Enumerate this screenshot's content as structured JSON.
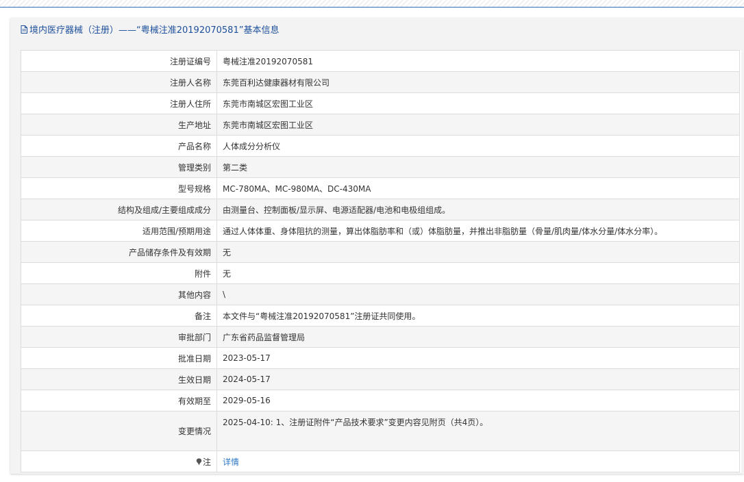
{
  "panel": {
    "title": "境内医疗器械（注册）——“粤械注准20192070581”基本信息",
    "title_color": "#1d4f9c",
    "icon": "document-icon"
  },
  "rows": [
    {
      "label": "注册证编号",
      "value": "粤械注准20192070581"
    },
    {
      "label": "注册人名称",
      "value": "东莞百利达健康器材有限公司"
    },
    {
      "label": "注册人住所",
      "value": "东莞市南城区宏图工业区"
    },
    {
      "label": "生产地址",
      "value": "东莞市南城区宏图工业区"
    },
    {
      "label": "产品名称",
      "value": "人体成分分析仪"
    },
    {
      "label": "管理类别",
      "value": "第二类"
    },
    {
      "label": "型号规格",
      "value": "MC-780MA、MC-980MA、DC-430MA"
    },
    {
      "label": "结构及组成/主要组成成分",
      "value": "由测量台、控制面板/显示屏、电源适配器/电池和电极组组成。"
    },
    {
      "label": "适用范围/预期用途",
      "value": "通过人体体重、身体阻抗的测量，算出体脂肪率和（或）体脂肪量，并推出非脂肪量（骨量/肌肉量/体水分量/体水分率）。"
    },
    {
      "label": "产品储存条件及有效期",
      "value": "无"
    },
    {
      "label": "附件",
      "value": "无"
    },
    {
      "label": "其他内容",
      "value": "\\"
    },
    {
      "label": "备注",
      "value": "本文件与“粤械注准20192070581”注册证共同使用。"
    },
    {
      "label": "审批部门",
      "value": "广东省药品监督管理局"
    },
    {
      "label": "批准日期",
      "value": "2023-05-17"
    },
    {
      "label": "生效日期",
      "value": "2024-05-17"
    },
    {
      "label": "有效期至",
      "value": "2029-05-16"
    },
    {
      "label": "变更情况",
      "value": "2025-04-10: 1、注册证附件“产品技术要求”变更内容见附页（共4页）。"
    }
  ],
  "note_row": {
    "label": "注",
    "icon": "pin-icon",
    "link_text": "详情",
    "link_color": "#2f79c6"
  },
  "colors": {
    "accent": "#2f6fb3",
    "alt_row": "#f5f5f5",
    "border": "#dcdcdc"
  }
}
